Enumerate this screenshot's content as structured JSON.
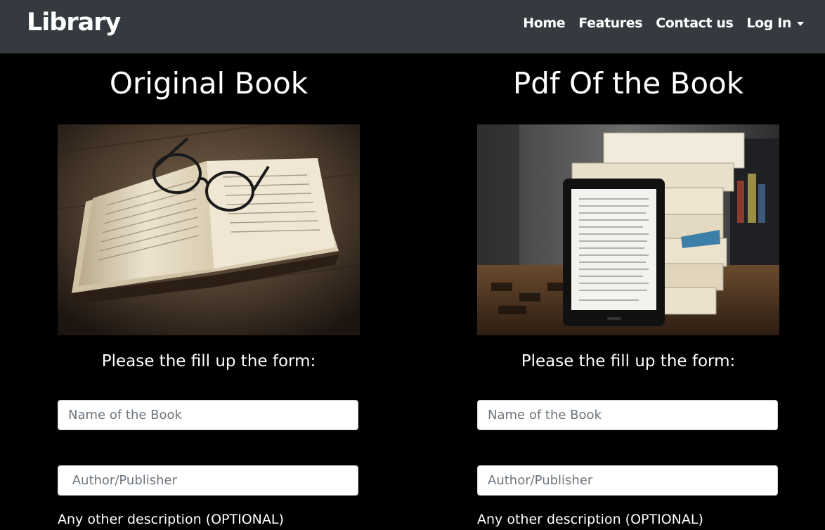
{
  "navbar": {
    "brand": "Library",
    "items": [
      {
        "label": "Home"
      },
      {
        "label": "Features"
      },
      {
        "label": "Contact us"
      },
      {
        "label": "Log In"
      }
    ]
  },
  "original": {
    "heading": "Original Book",
    "image": "open-book-with-glasses",
    "form_prompt": "Please the fill up the form:",
    "name_placeholder": "Name of the Book",
    "author_placeholder": " Author/Publisher",
    "description_label": "Any other description (OPTIONAL)"
  },
  "pdf": {
    "heading": "Pdf Of the Book",
    "image": "ereader-with-book-stack",
    "form_prompt": "Please the fill up the form:",
    "name_placeholder": "Name of the Book",
    "author_placeholder": "Author/Publisher",
    "description_label": "Any other description (OPTIONAL)"
  },
  "colors": {
    "navbar_bg": "#343a40",
    "page_bg": "#000000",
    "text": "#ffffff"
  }
}
